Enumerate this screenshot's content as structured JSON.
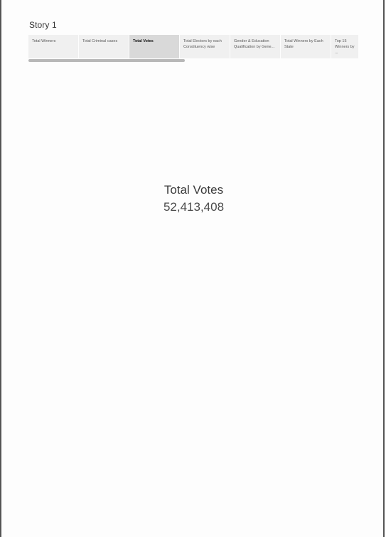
{
  "story": {
    "title": "Story 1"
  },
  "tabs": [
    {
      "label": "Total Winners",
      "active": false
    },
    {
      "label": "Total Criminal cases",
      "active": false
    },
    {
      "label": "Total Votes",
      "active": true
    },
    {
      "label": "Total Electors by each Constituency wise",
      "active": false
    },
    {
      "label": "Gender & Education Qualification by Gene...",
      "active": false
    },
    {
      "label": "Total Winners by Each State",
      "active": false
    },
    {
      "label": "Top 15 Winners by ...",
      "active": false
    }
  ],
  "kpi": {
    "label": "Total Votes",
    "value": "52,413,408"
  },
  "colors": {
    "active_tab": "#d9d9d9",
    "inactive_tab": "#f0f0f0",
    "scrollbar": "#b8b8b8",
    "border": "#555555"
  }
}
